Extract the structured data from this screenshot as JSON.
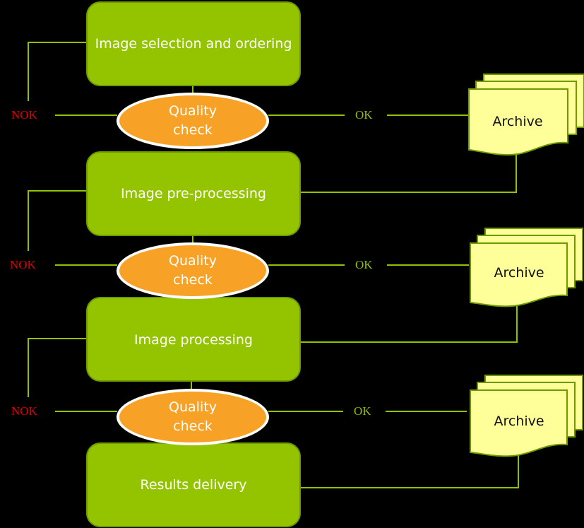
{
  "diagram": {
    "colors": {
      "process_fill": "#94c400",
      "process_border": "#6e9a00",
      "check_fill": "#f7a226",
      "check_border": "#ffffff",
      "archive_fill": "#ffff99",
      "archive_border": "#6e9a00",
      "line": "#8fc200",
      "nok": "#e00000",
      "ok": "#8fc200",
      "background": "#000000"
    },
    "steps": [
      {
        "label": "Image selection and ordering"
      },
      {
        "label": "Image pre-processing"
      },
      {
        "label": "Image processing"
      },
      {
        "label": "Results delivery"
      }
    ],
    "checks": [
      {
        "label": "Quality check",
        "nok_label": "NOK",
        "ok_label": "OK",
        "archive_label": "Archive"
      },
      {
        "label": "Quality check",
        "nok_label": "NOK",
        "ok_label": "OK",
        "archive_label": "Archive"
      },
      {
        "label": "Quality check",
        "nok_label": "NOK",
        "ok_label": "OK",
        "archive_label": "Archive"
      }
    ]
  }
}
